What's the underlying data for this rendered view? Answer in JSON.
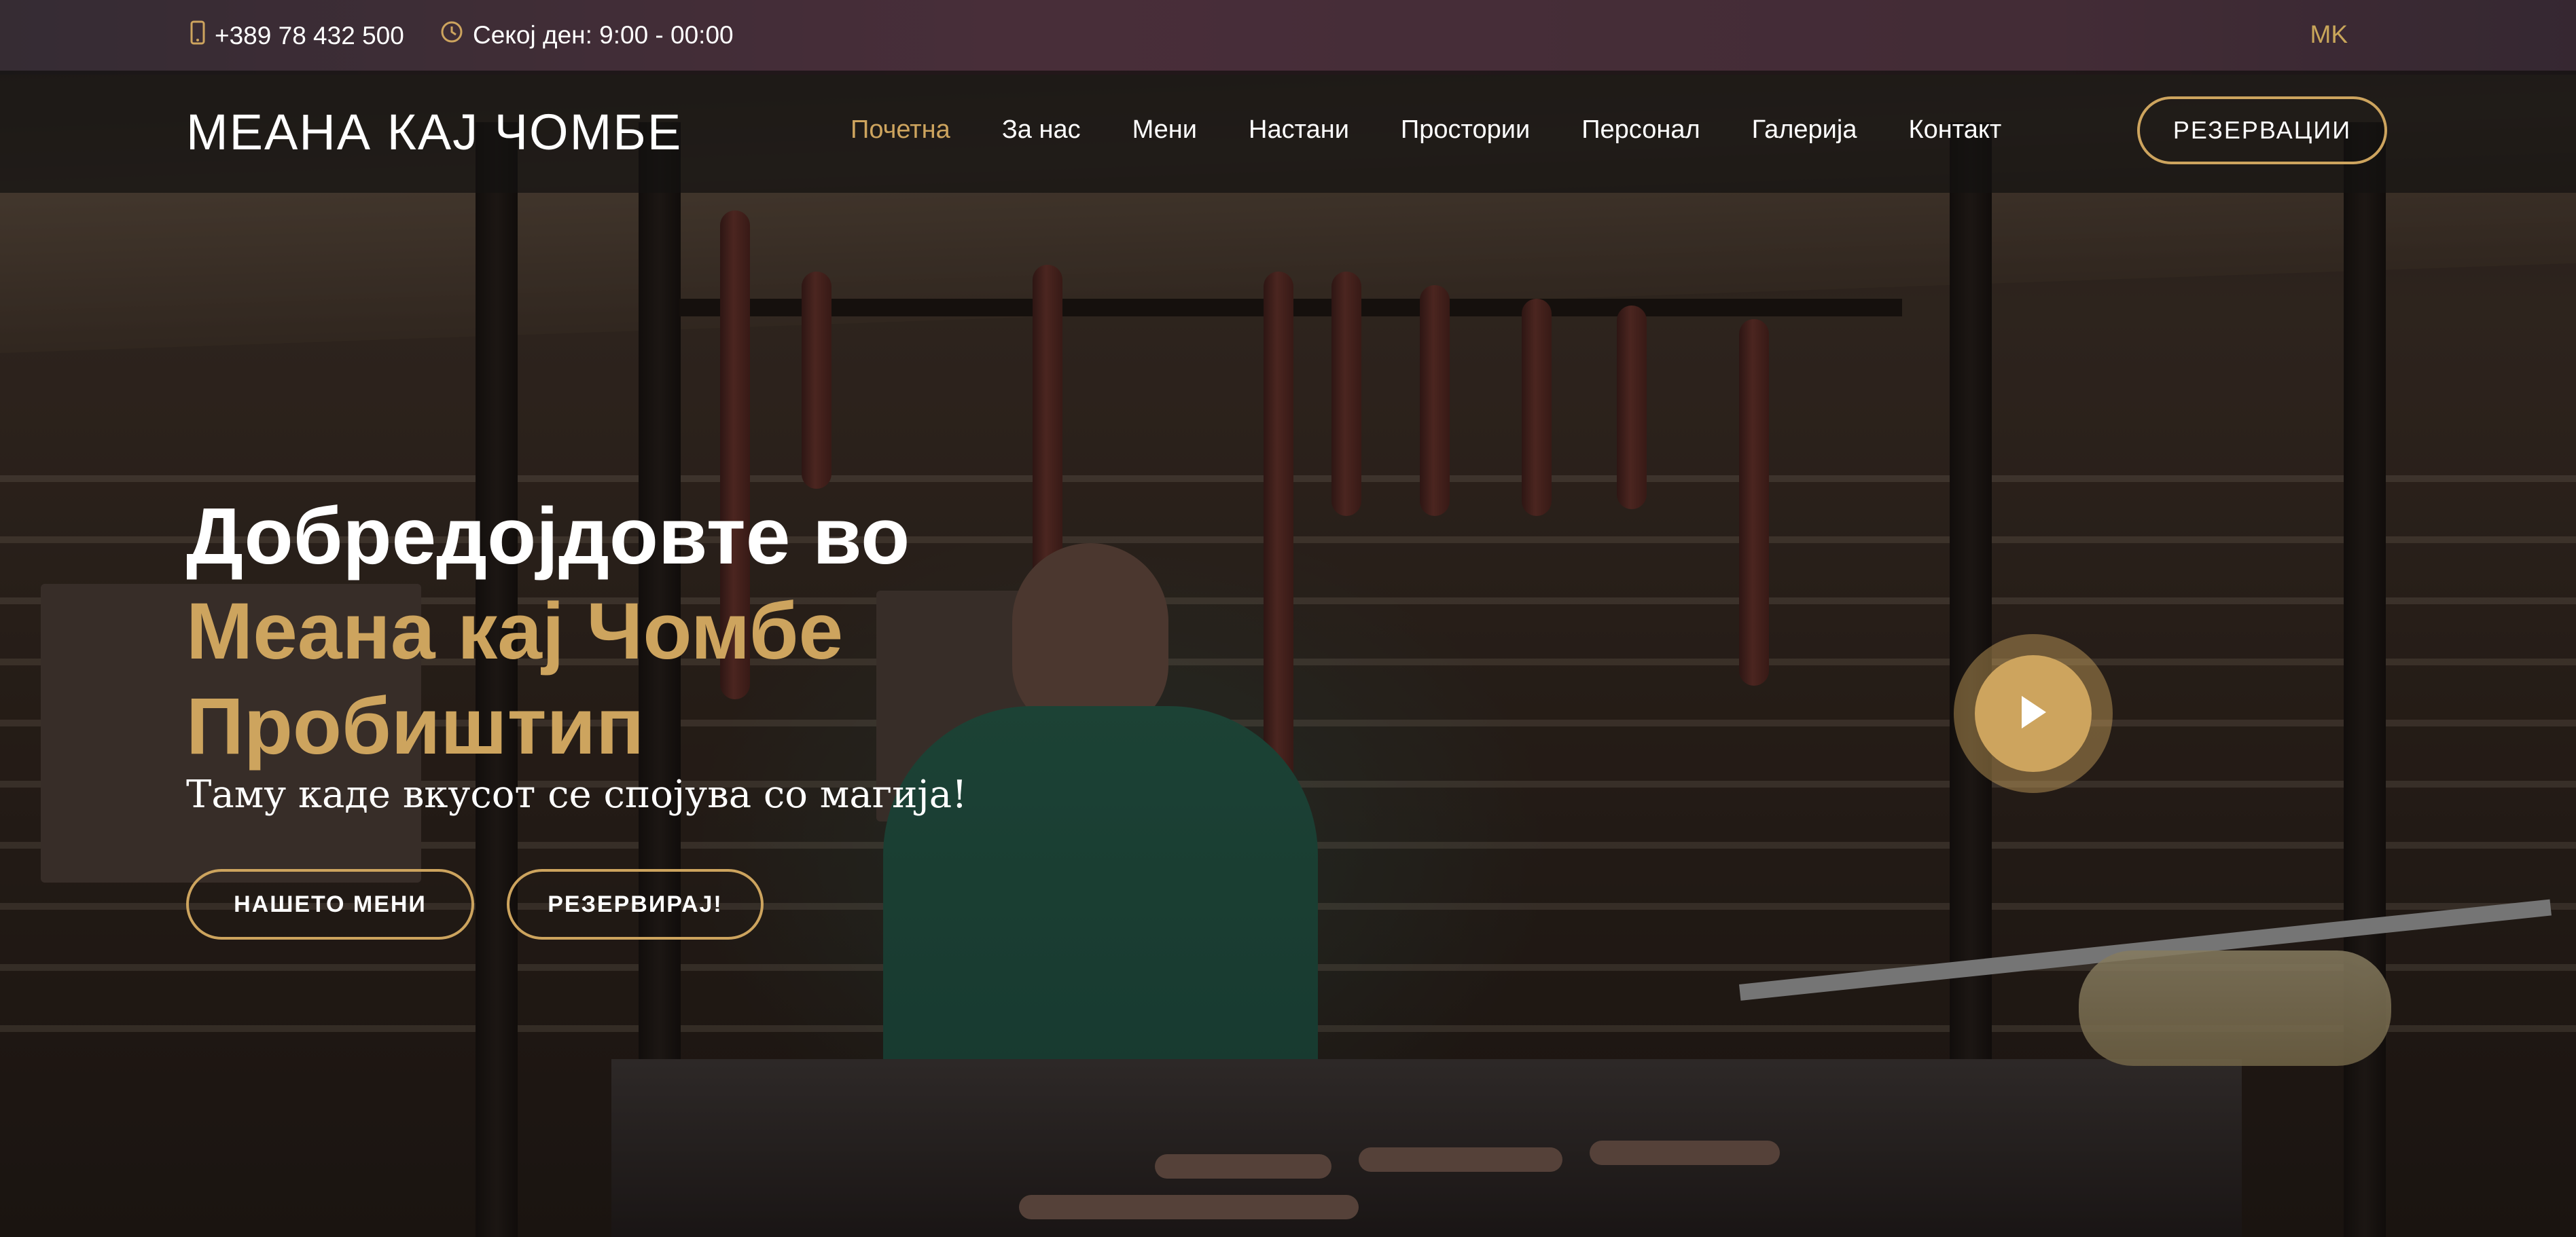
{
  "topbar": {
    "phone": "+389 78 432 500",
    "phone_icon": "mobile-phone-icon",
    "hours": "Секој ден: 9:00 - 00:00",
    "hours_icon": "clock-icon",
    "language": "MK"
  },
  "header": {
    "logo": "МЕАНА КАЈ ЧОМБЕ",
    "nav": [
      {
        "label": "Почетна",
        "active": true
      },
      {
        "label": "За нас"
      },
      {
        "label": "Мени"
      },
      {
        "label": "Настани"
      },
      {
        "label": "Простории"
      },
      {
        "label": "Персонал"
      },
      {
        "label": "Галерија"
      },
      {
        "label": "Контакт"
      }
    ],
    "reserve_label": "РЕЗЕРВАЦИИ"
  },
  "hero": {
    "line1": "Добредојдовте во",
    "line2": "Меана кај Чомбе",
    "line3": "Пробиштип",
    "tagline": "Таму каде вкусот се спојува со магија!",
    "btn_menu": "НАШЕТО МЕНИ",
    "btn_reserve": "РЕЗЕРВИРАЈ!",
    "play_icon": "play-icon"
  },
  "colors": {
    "accent": "#cda45e",
    "text": "#ffffff",
    "navbar_bg": "#141210"
  }
}
